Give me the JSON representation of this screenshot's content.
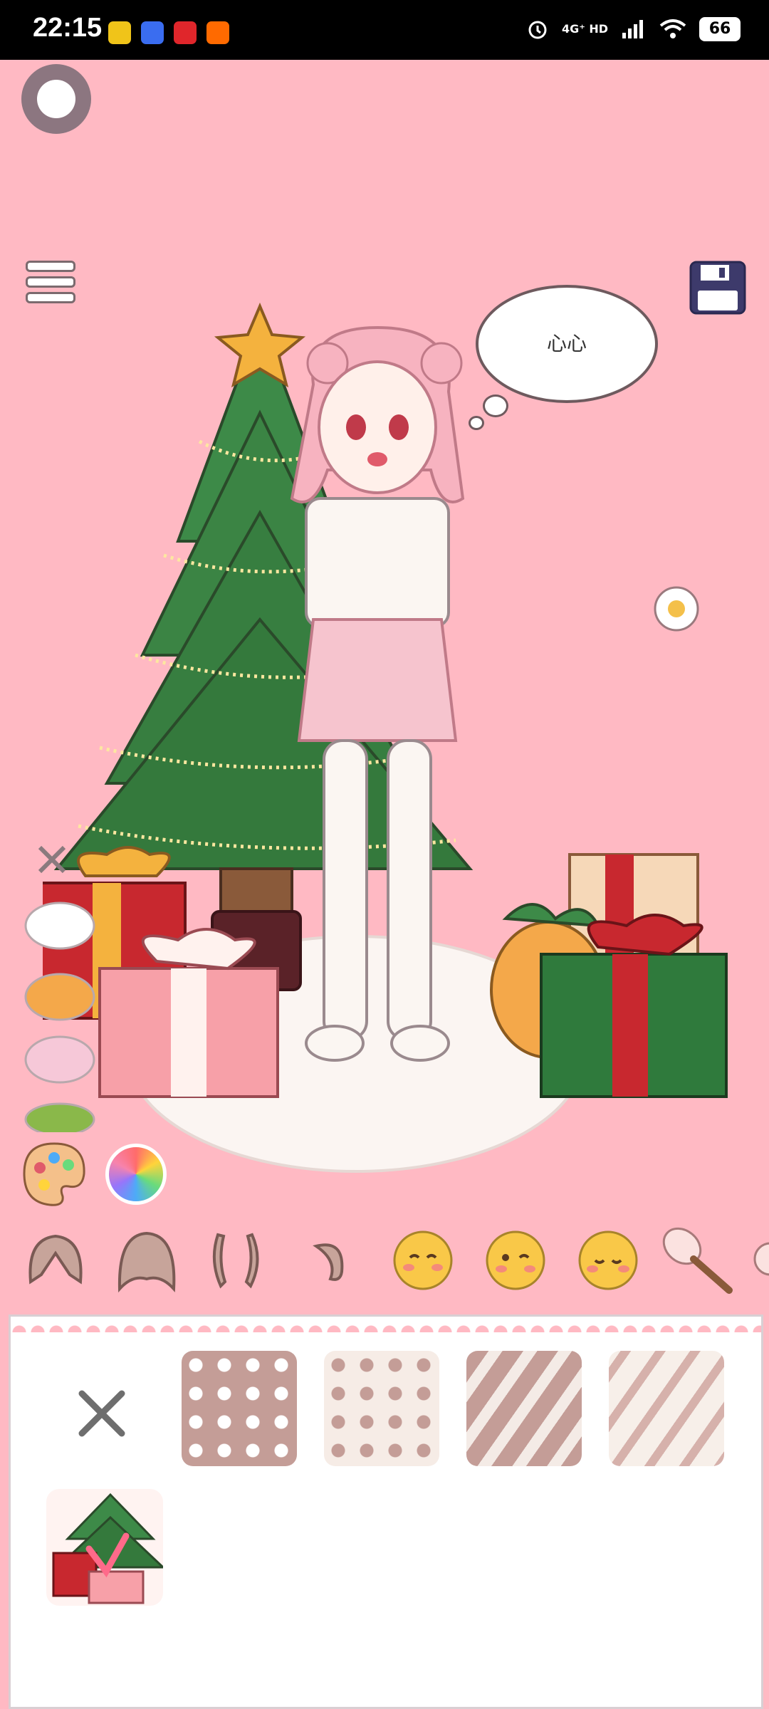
{
  "status_bar": {
    "time": "22:15",
    "network": "4G⁺ HD",
    "battery": "66",
    "app_icons": [
      "#f0c419",
      "#3a6df0",
      "#e0262b",
      "#ff6a00"
    ]
  },
  "scene": {
    "thought_bubble_text": "心心"
  },
  "colors": {
    "background": "#ffb9c3",
    "panel": "#ffffff",
    "tile_brown": "#c49d97"
  },
  "categories": [
    "hair-back-icon",
    "hair-front-icon",
    "side-hair-icon",
    "ahoge-icon",
    "face-blush-icon",
    "face-wink-icon",
    "face-smile-icon",
    "makeup-brush-icon"
  ],
  "pattern_options": [
    "close-icon",
    "brown-white-dots",
    "cream-brown-dots",
    "brown-stripes",
    "light-stripes"
  ],
  "background_option": "christmas-tree-thumbnail"
}
